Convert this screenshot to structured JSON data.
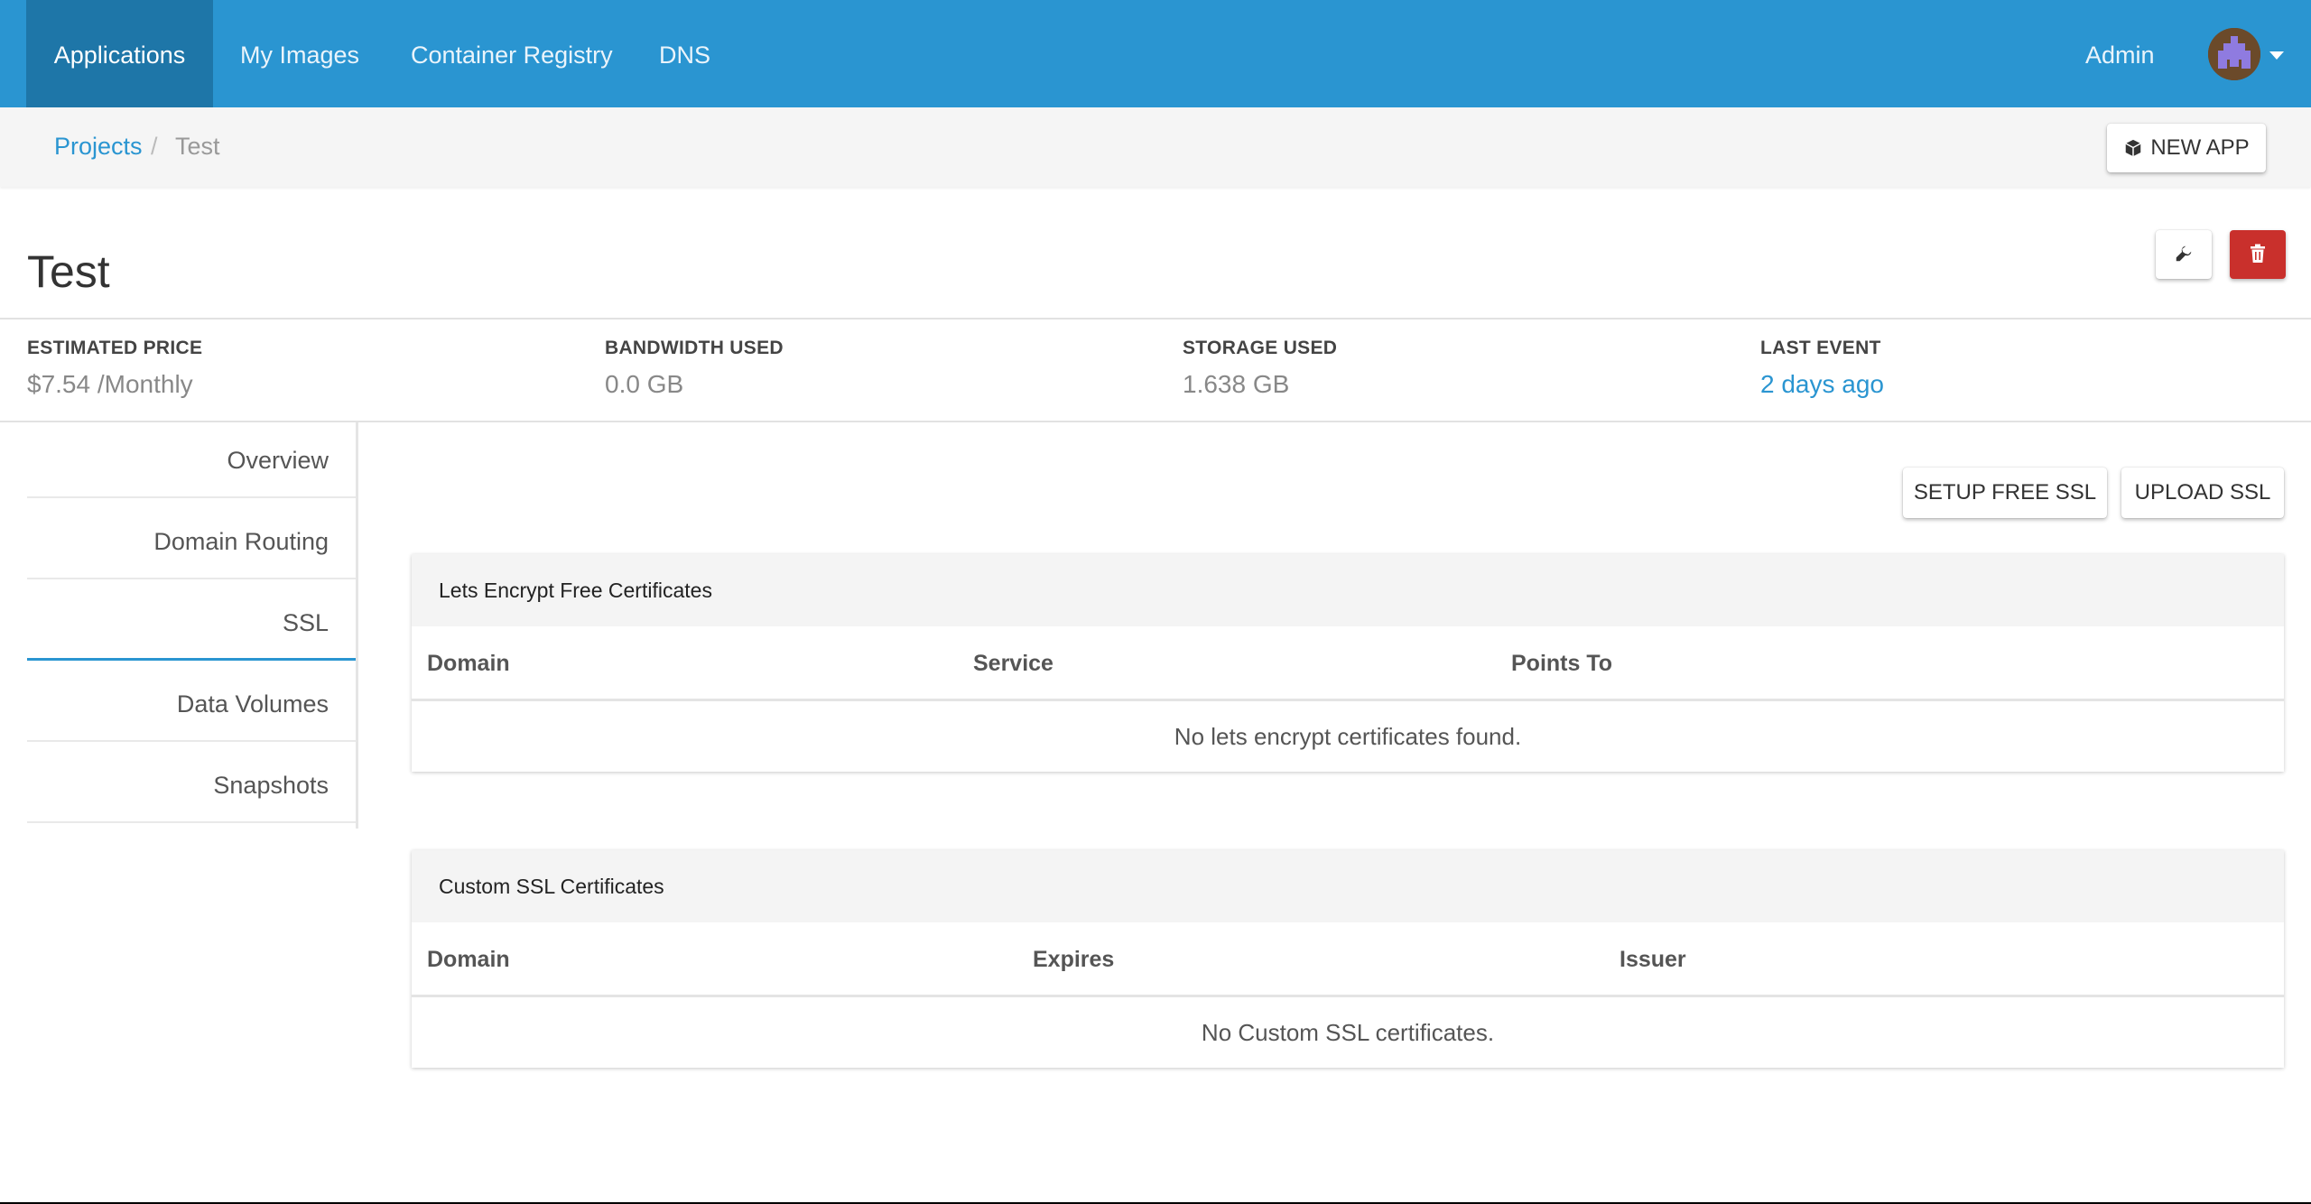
{
  "nav": {
    "items": [
      {
        "label": "Applications",
        "active": true
      },
      {
        "label": "My Images"
      },
      {
        "label": "Container Registry"
      },
      {
        "label": "DNS"
      }
    ],
    "admin_label": "Admin",
    "accent_color": "#2a95d1"
  },
  "breadcrumb": {
    "root": "Projects",
    "separator": "/",
    "current": "Test"
  },
  "toolbar": {
    "new_app_label": "NEW APP",
    "new_app_icon": "cube-icon",
    "settings_icon": "wrench-icon",
    "delete_icon": "trash-icon"
  },
  "project": {
    "title": "Test"
  },
  "stats": [
    {
      "label": "ESTIMATED PRICE",
      "value": "$7.54 /Monthly"
    },
    {
      "label": "BANDWIDTH USED",
      "value": "0.0 GB"
    },
    {
      "label": "STORAGE USED",
      "value": "1.638 GB"
    },
    {
      "label": "LAST EVENT",
      "value": "2 days ago"
    }
  ],
  "sidebar": {
    "items": [
      {
        "label": "Overview"
      },
      {
        "label": "Domain Routing"
      },
      {
        "label": "SSL",
        "active": true
      },
      {
        "label": "Data Volumes"
      },
      {
        "label": "Snapshots"
      }
    ]
  },
  "ssl": {
    "setup_free_label": "SETUP FREE SSL",
    "upload_label": "UPLOAD SSL",
    "letsencrypt": {
      "title": "Lets Encrypt Free Certificates",
      "columns": [
        "Domain",
        "Service",
        "Points To"
      ],
      "empty_text": "No lets encrypt certificates found."
    },
    "custom": {
      "title": "Custom SSL Certificates",
      "columns": [
        "Domain",
        "Expires",
        "Issuer"
      ],
      "empty_text": "No Custom SSL certificates."
    }
  }
}
